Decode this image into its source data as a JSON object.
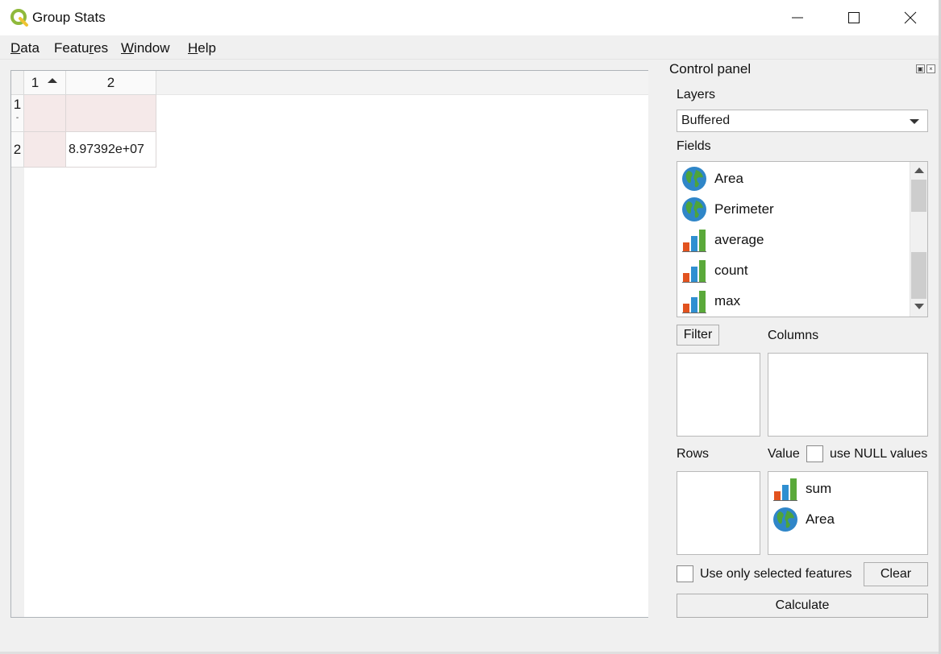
{
  "window": {
    "title": "Group Stats"
  },
  "menu": {
    "items": [
      {
        "label": "Data",
        "mnemonic": "D",
        "rest": "ata"
      },
      {
        "label": "Features",
        "pre": "Featu",
        "mnemonic": "r",
        "rest": "es"
      },
      {
        "label": "Window",
        "pre": "",
        "mnemonic": "W",
        "rest": "indow"
      },
      {
        "label": "Help",
        "pre": "",
        "mnemonic": "H",
        "rest": "elp"
      }
    ]
  },
  "table": {
    "columns": [
      "1",
      "2"
    ],
    "rows": [
      {
        "header": "1",
        "cells": [
          "",
          ""
        ]
      },
      {
        "header": "2",
        "cells": [
          "",
          "8.97392e+07"
        ]
      }
    ]
  },
  "control_panel": {
    "title": "Control panel",
    "layers_label": "Layers",
    "layer_selected": "Buffered",
    "fields_label": "Fields",
    "fields": [
      {
        "name": "Area",
        "icon": "globe-icon"
      },
      {
        "name": "Perimeter",
        "icon": "globe-icon"
      },
      {
        "name": "average",
        "icon": "bar-chart-icon"
      },
      {
        "name": "count",
        "icon": "bar-chart-icon"
      },
      {
        "name": "max",
        "icon": "bar-chart-icon"
      }
    ],
    "filter_button": "Filter",
    "columns_label": "Columns",
    "rows_label": "Rows",
    "value_label": "Value",
    "use_null_label": "use NULL values",
    "value_items": [
      {
        "name": "sum",
        "icon": "bar-chart-icon"
      },
      {
        "name": "Area",
        "icon": "globe-icon"
      }
    ],
    "use_selected_label": "Use only selected features",
    "clear_button": "Clear",
    "calculate_button": "Calculate"
  }
}
